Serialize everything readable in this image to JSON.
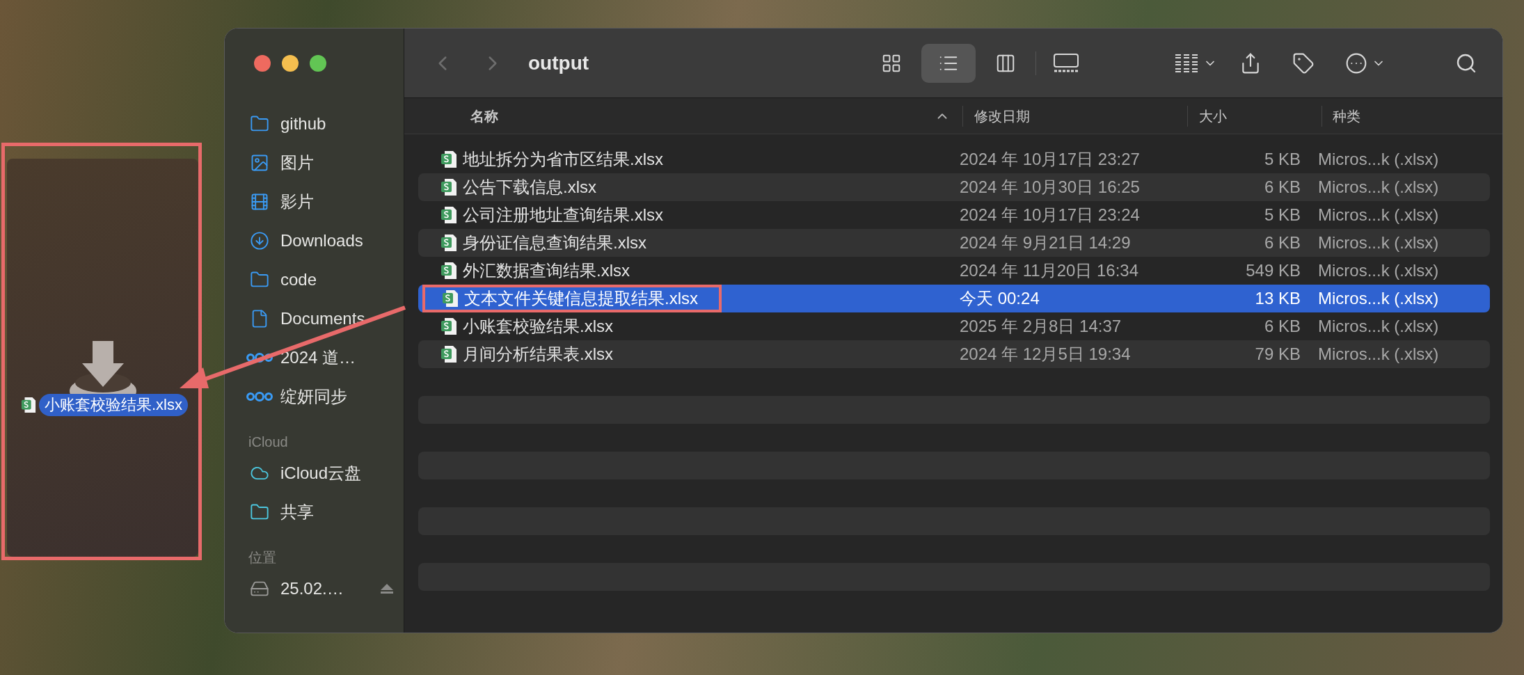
{
  "drop_panel": {
    "file_name": "小账套校验结果.xlsx"
  },
  "window": {
    "title": "output"
  },
  "navigation": {
    "back_enabled": false,
    "forward_enabled": false
  },
  "view_modes": [
    {
      "kind": "icons",
      "selected": false
    },
    {
      "kind": "list",
      "selected": true
    },
    {
      "kind": "columns",
      "selected": false
    },
    {
      "kind": "gallery",
      "selected": false
    }
  ],
  "sidebar": {
    "items": [
      {
        "label": "github",
        "kind": "folder"
      },
      {
        "label": "图片",
        "kind": "photos"
      },
      {
        "label": "影片",
        "kind": "movies"
      },
      {
        "label": "Downloads",
        "kind": "downloads"
      },
      {
        "label": "code",
        "kind": "folder"
      },
      {
        "label": "Documents",
        "kind": "document"
      },
      {
        "label": "2024 道…",
        "kind": "sync"
      },
      {
        "label": "绽妍同步",
        "kind": "sync"
      }
    ],
    "sections": [
      {
        "heading": "iCloud",
        "items": [
          {
            "label": "iCloud云盘",
            "kind": "cloud"
          },
          {
            "label": "共享",
            "kind": "shared"
          }
        ]
      },
      {
        "heading": "位置",
        "items": [
          {
            "label": "25.02.…",
            "kind": "drive"
          }
        ]
      }
    ]
  },
  "table": {
    "columns": [
      {
        "label": "名称",
        "sorted": true
      },
      {
        "label": "修改日期",
        "sorted": false
      },
      {
        "label": "大小",
        "sorted": false
      },
      {
        "label": "种类",
        "sorted": false
      }
    ],
    "rows": [
      {
        "name": "地址拆分为省市区结果.xlsx",
        "date": "2024 年 10月17日 23:27",
        "size": "5 KB",
        "kind": "Micros...k (.xlsx)",
        "selected": false,
        "annotated": false
      },
      {
        "name": "公告下载信息.xlsx",
        "date": "2024 年 10月30日 16:25",
        "size": "6 KB",
        "kind": "Micros...k (.xlsx)",
        "selected": false,
        "annotated": false
      },
      {
        "name": "公司注册地址查询结果.xlsx",
        "date": "2024 年 10月17日 23:24",
        "size": "5 KB",
        "kind": "Micros...k (.xlsx)",
        "selected": false,
        "annotated": false
      },
      {
        "name": "身份证信息查询结果.xlsx",
        "date": "2024 年 9月21日 14:29",
        "size": "6 KB",
        "kind": "Micros...k (.xlsx)",
        "selected": false,
        "annotated": false
      },
      {
        "name": "外汇数据查询结果.xlsx",
        "date": "2024 年 11月20日 16:34",
        "size": "549 KB",
        "kind": "Micros...k (.xlsx)",
        "selected": false,
        "annotated": false
      },
      {
        "name": "文本文件关键信息提取结果.xlsx",
        "date": "今天 00:24",
        "size": "13 KB",
        "kind": "Micros...k (.xlsx)",
        "selected": true,
        "annotated": true
      },
      {
        "name": "小账套校验结果.xlsx",
        "date": "2025 年 2月8日 14:37",
        "size": "6 KB",
        "kind": "Micros...k (.xlsx)",
        "selected": false,
        "annotated": false
      },
      {
        "name": "月间分析结果表.xlsx",
        "date": "2024 年 12月5日 19:34",
        "size": "79 KB",
        "kind": "Micros...k (.xlsx)",
        "selected": false,
        "annotated": false
      }
    ]
  }
}
